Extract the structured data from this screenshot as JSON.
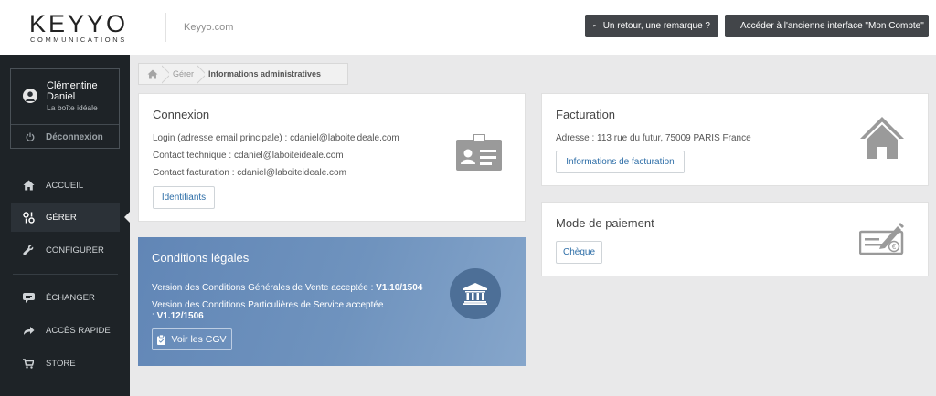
{
  "header": {
    "logo_text": "KEYYO",
    "logo_sub": "COMMUNICATIONS",
    "site_name": "Keyyo.com",
    "feedback_button": "Un retour, une remarque ?",
    "old_interface_button": "Accéder à l'ancienne interface \"Mon Compte\""
  },
  "user": {
    "first_name": "Clémentine",
    "last_name": "Daniel",
    "company": "La boîte idéale",
    "logout": "Déconnexion"
  },
  "nav": {
    "items": [
      {
        "label": "ACCUEIL",
        "icon": "home-icon"
      },
      {
        "label": "GÉRER",
        "icon": "manage-icon",
        "active": true
      },
      {
        "label": "CONFIGURER",
        "icon": "wrench-icon"
      },
      {
        "label": "ÉCHANGER",
        "icon": "chat-icon"
      },
      {
        "label": "ACCÈS RAPIDE",
        "icon": "share-icon"
      },
      {
        "label": "STORE",
        "icon": "cart-icon"
      }
    ]
  },
  "breadcrumb": {
    "items": [
      "Gérer",
      "Informations administratives"
    ]
  },
  "connexion": {
    "title": "Connexion",
    "login": "Login (adresse email principale) : cdaniel@laboiteideale.com",
    "tech": "Contact technique : cdaniel@laboiteideale.com",
    "billing": "Contact facturation : cdaniel@laboiteideale.com",
    "button": "Identifiants"
  },
  "facturation": {
    "title": "Facturation",
    "address": "Adresse : 113 rue du futur, 75009 PARIS France",
    "button": "Informations de facturation"
  },
  "paiement": {
    "title": "Mode de paiement",
    "button": "Chèque"
  },
  "conditions": {
    "title": "Conditions légales",
    "cgv_prefix": "Version des Conditions Générales de Vente acceptée : ",
    "cgv_version": "V1.10/1504",
    "cps_prefix": "Version des Conditions Particulières de Service acceptée",
    "cps_version_prefix": ": ",
    "cps_version": "V1.12/1506",
    "button": "Voir les CGV"
  },
  "colors": {
    "sidebar": "#1e2327",
    "accent_blue": "#6186b6",
    "link_blue": "#2f6fa8",
    "dark_button": "#424549"
  }
}
